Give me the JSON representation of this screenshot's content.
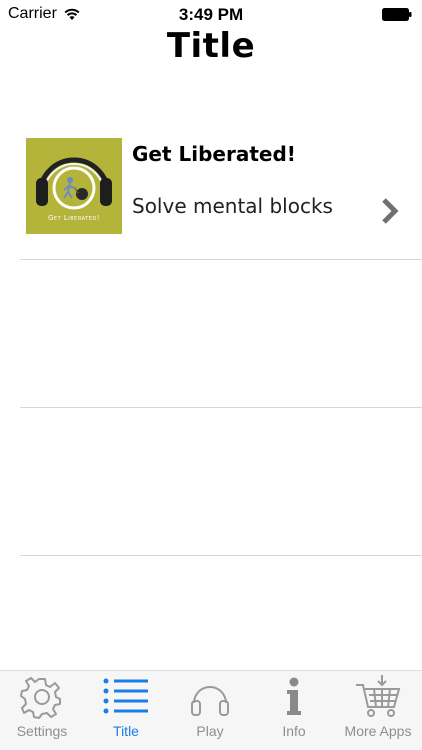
{
  "status_bar": {
    "carrier": "Carrier",
    "time": "3:49 PM"
  },
  "nav": {
    "title": "Title"
  },
  "list": {
    "items": [
      {
        "title": "Get Liberated!",
        "subtitle": "Solve mental blocks",
        "thumb_text": "Get Liberated!"
      }
    ]
  },
  "tabs": [
    {
      "label": "Settings",
      "icon": "gear-icon"
    },
    {
      "label": "Title",
      "icon": "list-icon"
    },
    {
      "label": "Play",
      "icon": "headphones-icon"
    },
    {
      "label": "Info",
      "icon": "info-icon"
    },
    {
      "label": "More Apps",
      "icon": "cart-icon"
    }
  ],
  "active_tab": "Title",
  "colors": {
    "accent": "#1a7ee6",
    "inactive": "#8e8e8e",
    "thumb_bg": "#b4b33a"
  }
}
